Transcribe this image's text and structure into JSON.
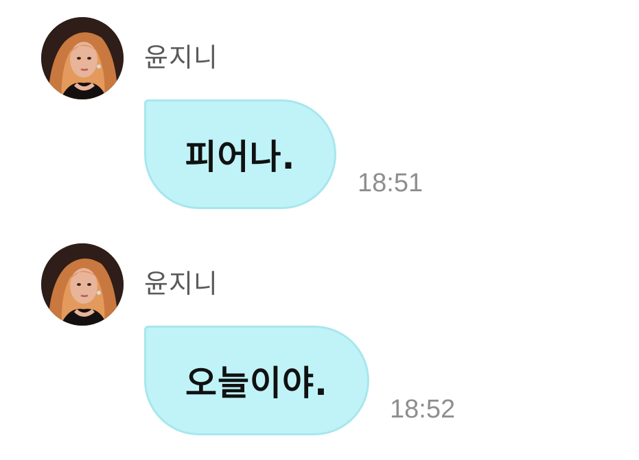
{
  "colors": {
    "bubble_background": "#bff3f7",
    "bubble_border": "#a8e6ee",
    "sender_text": "#5a5a5a",
    "time_text": "#8e8e8e",
    "message_text": "#111111"
  },
  "messages": [
    {
      "sender": "윤지니",
      "text": "피어나.",
      "time": "18:51",
      "avatar_icon": "profile-photo"
    },
    {
      "sender": "윤지니",
      "text": "오늘이야.",
      "time": "18:52",
      "avatar_icon": "profile-photo"
    }
  ]
}
